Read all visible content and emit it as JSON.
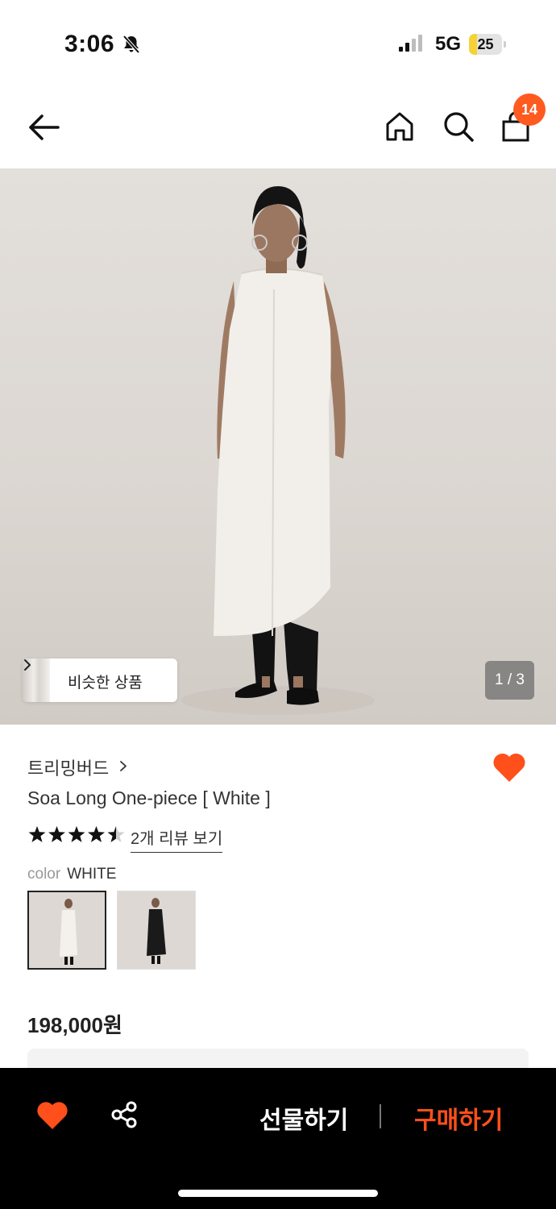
{
  "status_bar": {
    "time": "3:06",
    "network": "5G",
    "battery": "25",
    "battery_level": 0.25
  },
  "nav": {
    "cart_count": "14",
    "icons": [
      "back-arrow-icon",
      "home-icon",
      "search-icon",
      "shopping-bag-icon"
    ]
  },
  "gallery": {
    "similar_label": "비슷한 상품",
    "page_indicator": "1 / 3"
  },
  "product": {
    "brand": "트리밍버드",
    "title": "Soa Long One-piece [ White ]",
    "rating": 4.5,
    "review_link": "2개 리뷰 보기",
    "color_label": "color",
    "color_value": "WHITE",
    "swatches": [
      "white",
      "black"
    ],
    "price": "198,000원"
  },
  "bottom_bar": {
    "gift_label": "선물하기",
    "buy_label": "구매하기"
  },
  "colors": {
    "accent": "#ff5a1f",
    "buy": "#ff4f1a",
    "bottom_bar": "#000000"
  }
}
